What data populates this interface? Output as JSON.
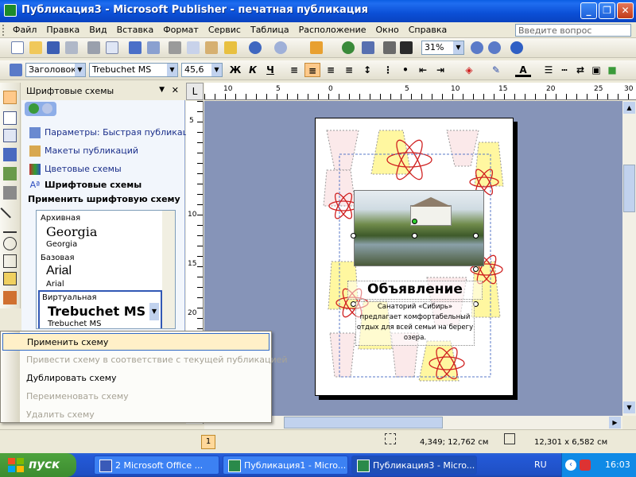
{
  "window": {
    "title": "Публикация3 - Microsoft Publisher - печатная публикация",
    "controls": {
      "minimize": "_",
      "maximize": "❐",
      "close": "✕"
    }
  },
  "menu": {
    "items": [
      "Файл",
      "Правка",
      "Вид",
      "Вставка",
      "Формат",
      "Сервис",
      "Таблица",
      "Расположение",
      "Окно",
      "Справка"
    ],
    "help_placeholder": "Введите вопрос"
  },
  "standard_toolbar": {
    "zoom": "31%"
  },
  "format_toolbar": {
    "style": "Заголовок",
    "font": "Trebuchet MS",
    "size": "45,6",
    "bold": "Ж",
    "italic": "К",
    "underline": "Ч"
  },
  "task_pane": {
    "title": "Шрифтовые схемы",
    "close": "✕",
    "links": [
      "Параметры: Быстрая публикация",
      "Макеты публикаций",
      "Цветовые схемы",
      "Шрифтовые схемы"
    ],
    "apply_label": "Применить шрифтовую схему",
    "schemes": [
      {
        "name": "Архивная",
        "heading": "Georgia",
        "body": "Georgia"
      },
      {
        "name": "Базовая",
        "heading": "Arial",
        "body": "Arial"
      },
      {
        "name": "Виртуальная",
        "heading": "Trebuchet MS",
        "body": "Trebuchet MS"
      }
    ]
  },
  "context_menu": {
    "items": [
      {
        "label": "Применить схему",
        "state": "highlighted"
      },
      {
        "label": "Привести схему в соответствие с текущей публикацией",
        "state": "disabled"
      },
      {
        "label": "Дублировать схему",
        "state": "enabled"
      },
      {
        "label": "Переименовать схему",
        "state": "disabled"
      },
      {
        "label": "Удалить схему",
        "state": "disabled"
      }
    ]
  },
  "ruler": {
    "h_labels": [
      "10",
      "5",
      "0",
      "5",
      "10",
      "15",
      "20",
      "25",
      "30"
    ],
    "v_labels": [
      "5",
      "10",
      "15",
      "20"
    ],
    "corner": "L"
  },
  "publication": {
    "heading": "Объявление",
    "body": "Санаторий «Сибирь» предлагает комфортабельный отдых для всей семьи на берегу озера."
  },
  "status": {
    "page": "1",
    "position": "4,349; 12,762 см",
    "size": "12,301 x 6,582 см"
  },
  "taskbar": {
    "start": "пуск",
    "tasks": [
      "2 Microsoft Office ...",
      "Публикация1 - Micro...",
      "Публикация3 - Micro..."
    ],
    "lang": "RU",
    "time": "16:03"
  }
}
